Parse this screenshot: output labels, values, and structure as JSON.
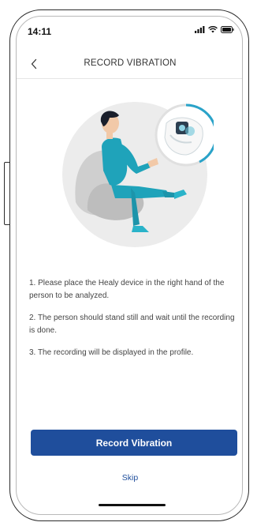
{
  "status_bar": {
    "time": "14:11",
    "icons": [
      "signal-icon",
      "wifi-icon",
      "battery-icon"
    ]
  },
  "header": {
    "title": "RECORD VIBRATION",
    "back_icon": "chevron-left-icon"
  },
  "instructions": [
    "1. Please place the Healy device in the right hand of the person to be analyzed.",
    "2. The person should stand still and wait until the recording is done.",
    "3. The recording will be displayed in the profile."
  ],
  "actions": {
    "primary_label": "Record Vibration",
    "skip_label": "Skip"
  },
  "colors": {
    "primary": "#1f4e9c",
    "accent": "#2aa3c9",
    "shirt": "#1fa3ba",
    "circle_bg": "#ececec"
  }
}
